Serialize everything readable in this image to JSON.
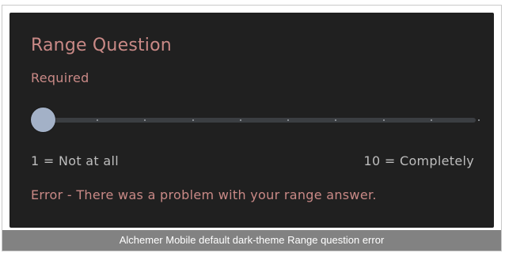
{
  "question": {
    "title": "Range Question",
    "required_label": "Required"
  },
  "slider": {
    "min_label": "1 = Not at all",
    "max_label": "10 = Completely",
    "min_value": 1,
    "max_value": 10,
    "selected_value": 1,
    "tick_count": 10
  },
  "error": {
    "message": "Error - There was a problem with your range answer."
  },
  "caption": "Alchemer Mobile default dark-theme Range question error",
  "colors": {
    "panel_background": "#202020",
    "accent_error": "#c98986",
    "muted_text": "#bdbdbd",
    "track": "#3b3e42",
    "thumb": "#a3b1c7",
    "caption_background": "#828282"
  }
}
